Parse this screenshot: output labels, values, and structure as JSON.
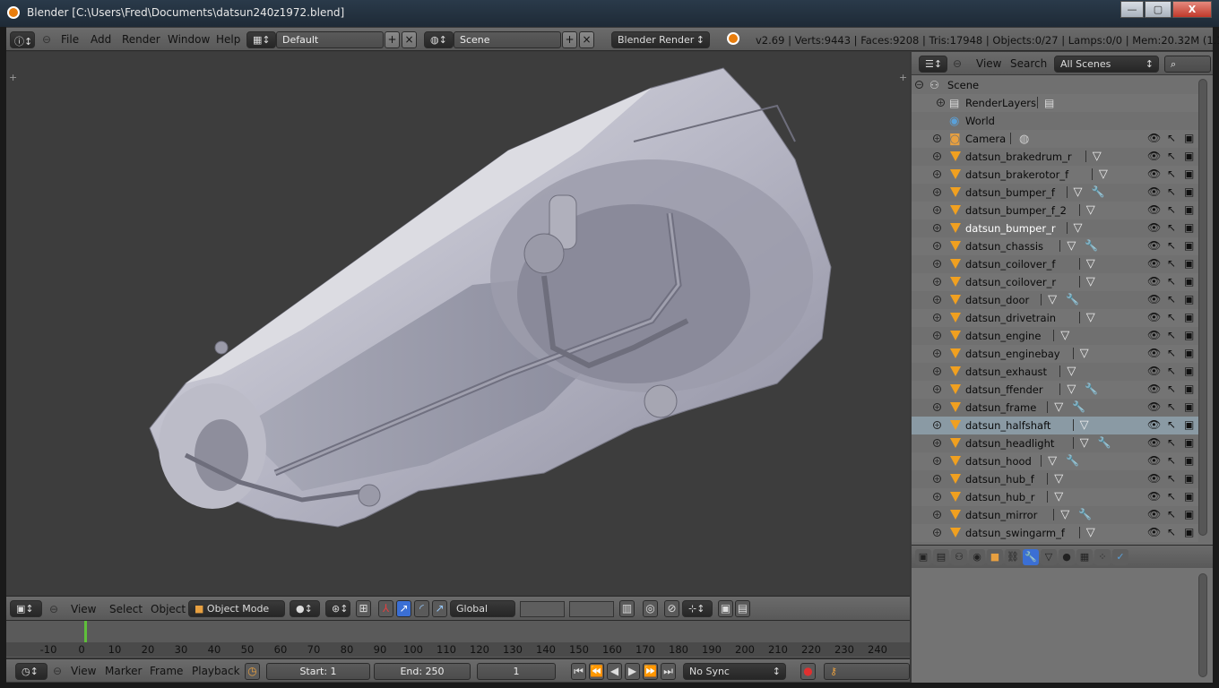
{
  "window": {
    "title": "Blender [C:\\Users\\Fred\\Documents\\datsun240z1972.blend]",
    "minimize": "—",
    "maximize": "▢",
    "close": "X"
  },
  "info_header": {
    "menus": [
      "File",
      "Add",
      "Render",
      "Window",
      "Help"
    ],
    "screen_layout": "Default",
    "scene": "Scene",
    "render_engine": "Blender Render",
    "stats": "v2.69 | Verts:9443 | Faces:9208 | Tris:17948 | Objects:0/27 | Lamps:0/0 | Mem:20.32M (1.11M) | dats"
  },
  "viewport_header": {
    "menus": [
      "View",
      "Select",
      "Object"
    ],
    "mode": "Object Mode",
    "transform_orientation": "Global"
  },
  "timeline": {
    "ticks": [
      "-10",
      "0",
      "10",
      "20",
      "30",
      "40",
      "50",
      "60",
      "70",
      "80",
      "90",
      "100",
      "110",
      "120",
      "130",
      "140",
      "150",
      "160",
      "170",
      "180",
      "190",
      "200",
      "210",
      "220",
      "230",
      "240"
    ],
    "current_frame_marker": "0"
  },
  "timeline_header": {
    "menus": [
      "View",
      "Marker",
      "Frame",
      "Playback"
    ],
    "start": "Start: 1",
    "end": "End: 250",
    "current": "1",
    "sync": "No Sync"
  },
  "outliner": {
    "menus": [
      "View",
      "Search"
    ],
    "display_mode": "All Scenes",
    "scene_label": "Scene",
    "render_layers": "RenderLayers",
    "world": "World",
    "camera": "Camera",
    "objects": [
      {
        "name": "datsun_brakedrum_r",
        "modifier": false
      },
      {
        "name": "datsun_brakerotor_f",
        "modifier": false
      },
      {
        "name": "datsun_bumper_f",
        "modifier": true
      },
      {
        "name": "datsun_bumper_f_2",
        "modifier": false
      },
      {
        "name": "datsun_bumper_r",
        "modifier": false
      },
      {
        "name": "datsun_chassis",
        "modifier": true
      },
      {
        "name": "datsun_coilover_f",
        "modifier": false
      },
      {
        "name": "datsun_coilover_r",
        "modifier": false
      },
      {
        "name": "datsun_door",
        "modifier": true
      },
      {
        "name": "datsun_drivetrain",
        "modifier": false
      },
      {
        "name": "datsun_engine",
        "modifier": false
      },
      {
        "name": "datsun_enginebay",
        "modifier": false
      },
      {
        "name": "datsun_exhaust",
        "modifier": false
      },
      {
        "name": "datsun_ffender",
        "modifier": true
      },
      {
        "name": "datsun_frame",
        "modifier": true
      },
      {
        "name": "datsun_halfshaft",
        "modifier": false
      },
      {
        "name": "datsun_headlight",
        "modifier": true
      },
      {
        "name": "datsun_hood",
        "modifier": true
      },
      {
        "name": "datsun_hub_f",
        "modifier": false
      },
      {
        "name": "datsun_hub_r",
        "modifier": false
      },
      {
        "name": "datsun_mirror",
        "modifier": true
      },
      {
        "name": "datsun_swingarm_f",
        "modifier": false
      }
    ]
  },
  "colors": {
    "accent_blue": "#3b6fd4",
    "object_orange": "#f0a020",
    "frame_green": "#5fbf3a",
    "viewport_bg": "#3d3d3d"
  }
}
